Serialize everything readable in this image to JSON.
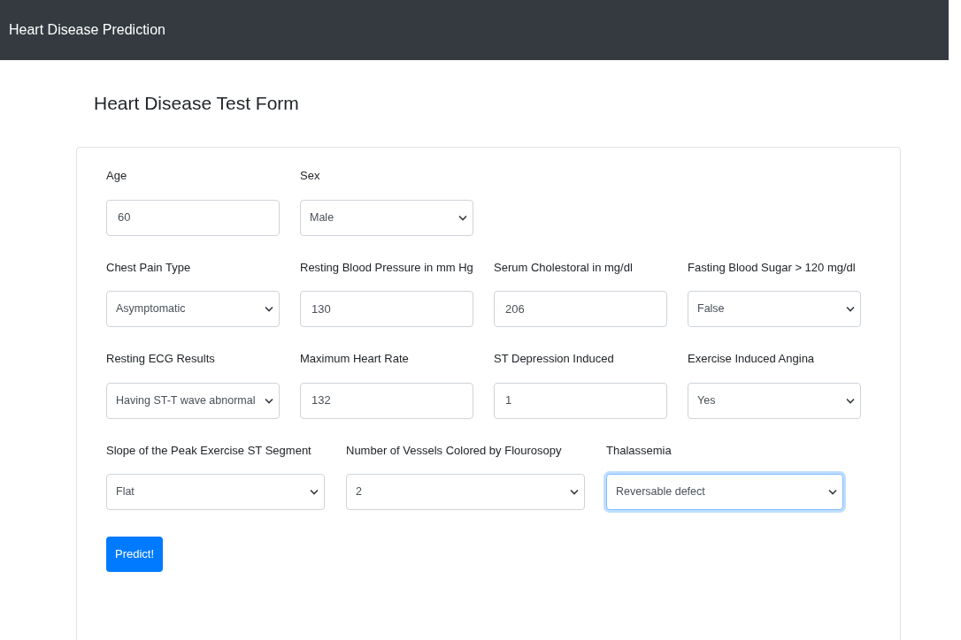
{
  "navbar": {
    "brand": "Heart Disease Prediction"
  },
  "form": {
    "title": "Heart Disease Test Form",
    "rows": [
      {
        "kind": "four_column",
        "fields": [
          {
            "label": "Age",
            "kind": "text",
            "value": "60",
            "focused": false
          },
          {
            "label": "Sex",
            "kind": "select",
            "value": "Male",
            "focused": false
          }
        ]
      },
      {
        "kind": "four_column",
        "fields": [
          {
            "label": "Chest Pain Type",
            "kind": "select",
            "value": "Asymptomatic",
            "focused": false
          },
          {
            "label": "Resting Blood Pressure in mm Hg",
            "kind": "text",
            "value": "130",
            "focused": false
          },
          {
            "label": "Serum Cholestoral in mg/dl",
            "kind": "text",
            "value": "206",
            "focused": false
          },
          {
            "label": "Fasting Blood Sugar > 120 mg/dl",
            "kind": "select",
            "value": "False",
            "focused": false
          }
        ]
      },
      {
        "kind": "four_column",
        "fields": [
          {
            "label": "Resting ECG Results",
            "kind": "select",
            "value": "Having ST-T wave abnormal",
            "focused": false
          },
          {
            "label": "Maximum Heart Rate",
            "kind": "text",
            "value": "132",
            "focused": false
          },
          {
            "label": "ST Depression Induced",
            "kind": "text",
            "value": "1",
            "focused": false
          },
          {
            "label": "Exercise Induced Angina",
            "kind": "select",
            "value": "Yes",
            "focused": false
          }
        ]
      },
      {
        "kind": "three_column",
        "fields": [
          {
            "label": "Slope of the Peak Exercise ST Segment",
            "kind": "select",
            "value": "Flat",
            "focused": false
          },
          {
            "label": "Number of Vessels Colored by Flourosopy",
            "kind": "select",
            "value": "2",
            "focused": false
          },
          {
            "label": "Thalassemia",
            "kind": "select",
            "value": "Reversable defect",
            "focused": true
          }
        ]
      }
    ],
    "submit": "Predict!"
  }
}
